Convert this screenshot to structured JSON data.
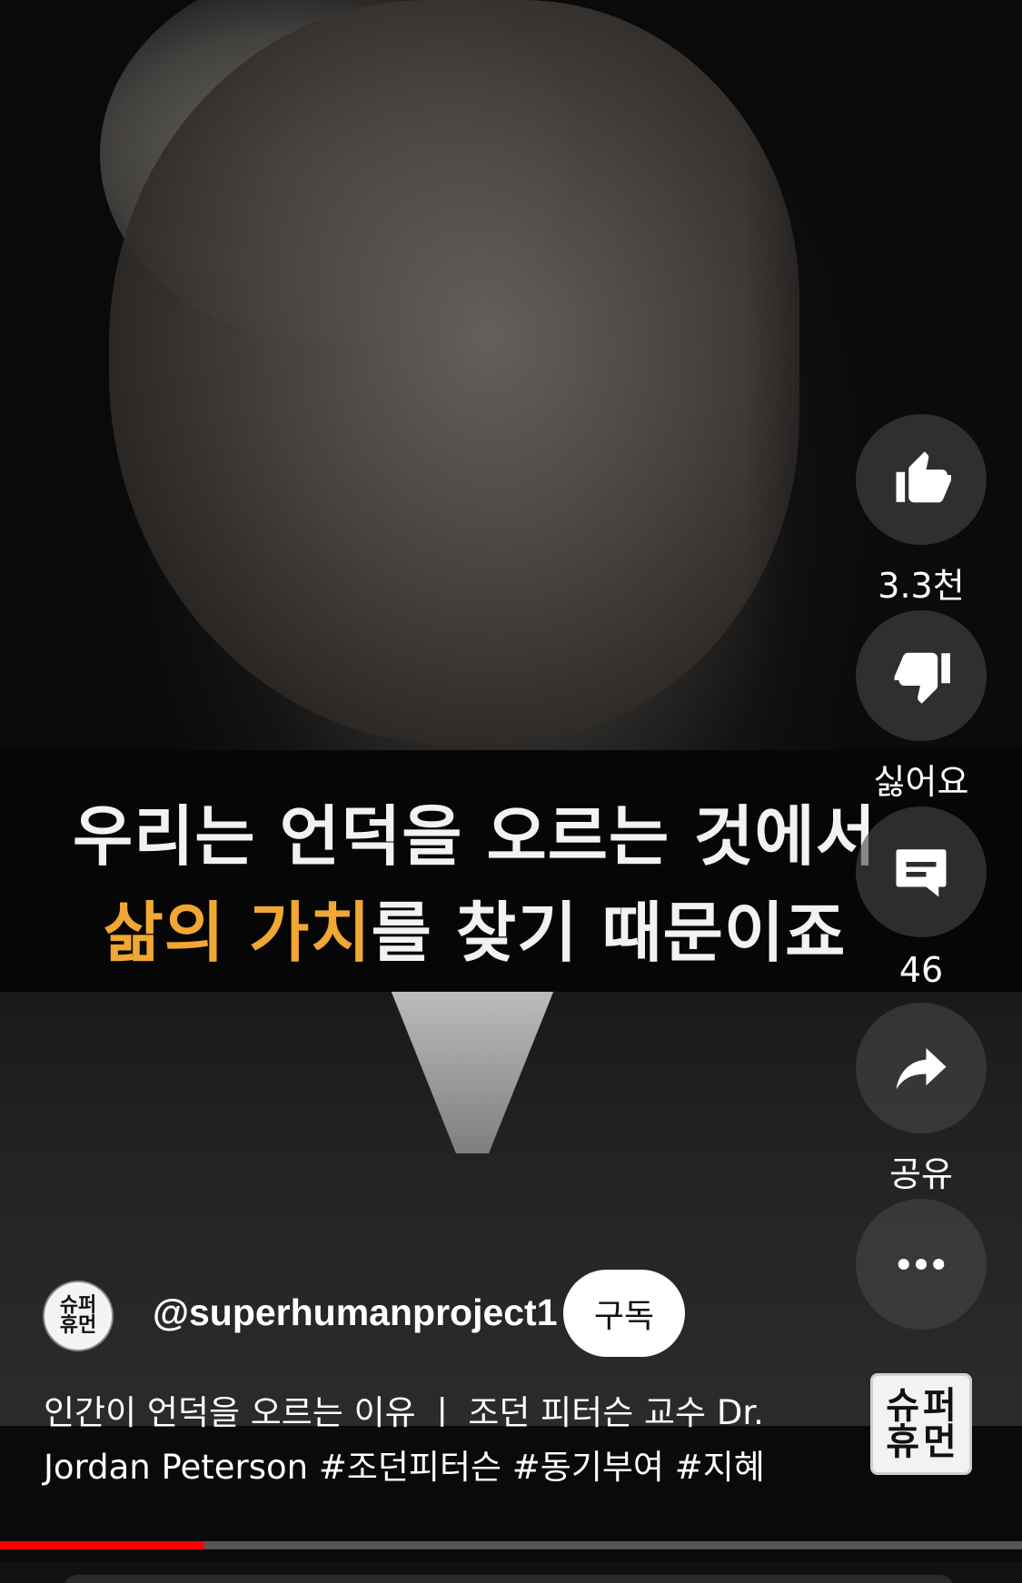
{
  "caption": {
    "line1": "우리는 언덕을 오르는 것에서",
    "line2_highlight": "삶의 가치",
    "line2_rest": "를 찾기 때문이죠",
    "highlight_color": "#f0a733"
  },
  "actions": {
    "like_count": "3.3천",
    "dislike_label": "싫어요",
    "comment_count": "46",
    "share_label": "공유"
  },
  "channel": {
    "handle": "@superhumanproject1",
    "subscribe_label": "구독",
    "logo_chars": [
      "슈",
      "퍼",
      "휴",
      "먼"
    ]
  },
  "video": {
    "title_line1": "인간이 언덕을 오르는 이유 ㅣ 조던 피터슨 교수 Dr.",
    "title_line2": "Jordan Peterson #조던피터슨 #동기부여 #지혜"
  },
  "progress": {
    "played_fraction": 0.2,
    "played_color": "#ff0000"
  },
  "icons": [
    "thumbs-up-icon",
    "thumbs-down-icon",
    "comment-icon",
    "share-icon",
    "more-icon"
  ]
}
